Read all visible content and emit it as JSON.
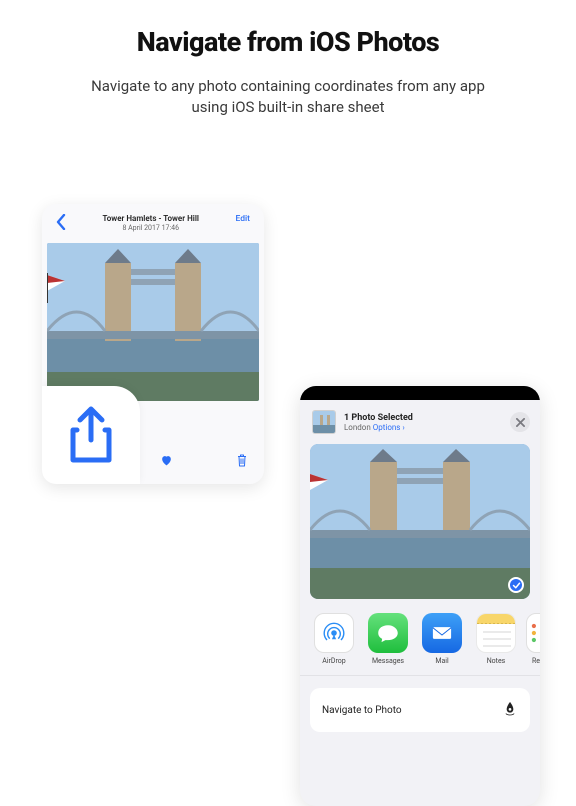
{
  "heading": "Navigate from iOS Photos",
  "subheading": "Navigate to any photo containing coordinates from any app using iOS built-in share sheet",
  "photos_detail": {
    "location_title": "Tower Hamlets - Tower Hill",
    "date_time": "8 April 2017  17:46",
    "edit_label": "Edit"
  },
  "share_sheet": {
    "header_title": "1 Photo Selected",
    "header_subtitle": "London",
    "options_label": "Options",
    "apps": [
      {
        "label": "AirDrop"
      },
      {
        "label": "Messages"
      },
      {
        "label": "Mail"
      },
      {
        "label": "Notes"
      },
      {
        "label": "Re"
      }
    ],
    "action_label": "Navigate to Photo"
  }
}
